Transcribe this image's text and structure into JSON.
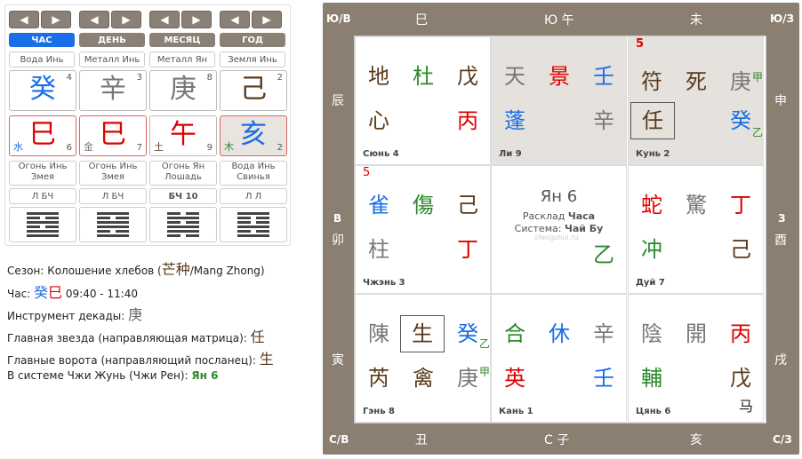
{
  "nav": [
    "◀",
    "▶"
  ],
  "tabs": [
    {
      "label": "ЧАС",
      "active": true
    },
    {
      "label": "ДЕНЬ",
      "active": false
    },
    {
      "label": "МЕСЯЦ",
      "active": false
    },
    {
      "label": "ГОД",
      "active": false
    }
  ],
  "stem_elements": [
    "Вода Инь",
    "Металл Инь",
    "Металл Ян",
    "Земля Инь"
  ],
  "stems": [
    {
      "glyph": "癸",
      "num": "4",
      "color": "#1a6ee8"
    },
    {
      "glyph": "辛",
      "num": "3",
      "color": "#777"
    },
    {
      "glyph": "庚",
      "num": "8",
      "color": "#777"
    },
    {
      "glyph": "己",
      "num": "2",
      "color": "#5a3a1a"
    }
  ],
  "branches": [
    {
      "glyph": "巳",
      "num": "6",
      "elem": "水",
      "elem_color": "#1a6ee8",
      "color": "#d00"
    },
    {
      "glyph": "巳",
      "num": "7",
      "elem": "金",
      "elem_color": "#777",
      "color": "#d00"
    },
    {
      "glyph": "午",
      "num": "9",
      "elem": "土",
      "elem_color": "#5a3a1a",
      "color": "#d00"
    },
    {
      "glyph": "亥",
      "num": "2",
      "elem": "木",
      "elem_color": "#2a8a2a",
      "color": "#1a6ee8"
    }
  ],
  "animals": [
    [
      "Огонь Инь",
      "Змея"
    ],
    [
      "Огонь Инь",
      "Змея"
    ],
    [
      "Огонь Ян",
      "Лошадь"
    ],
    [
      "Вода Инь",
      "Свинья"
    ]
  ],
  "small": [
    "Л БЧ",
    "Л БЧ",
    "БЧ 10",
    "Л Л"
  ],
  "info": {
    "season_label": "Сезон: Колошение хлебов (",
    "season_cn": "芒种",
    "season_tail": "/Mang Zhong)",
    "hour_label": "Час: ",
    "hour_g1": "癸",
    "hour_g2": "巳",
    "hour_time": " 09:40 - 11:40",
    "decade_label": "Инструмент декады: ",
    "decade_val": "庚",
    "star_label": "Главная звезда (направляющая матрица): ",
    "star_val": "任",
    "gate_label": "Главные ворота (направляющий посланец): ",
    "gate_val": "生",
    "sys_label": "В системе Чжи Жунь (Чжи Рен): ",
    "sys_val": "Ян 6"
  },
  "board": {
    "nw": "Ю/В",
    "ne": "Ю/З",
    "sw": "С/В",
    "se": "С/З",
    "top": [
      "巳",
      "Ю 午",
      "未"
    ],
    "bottom": [
      "丑",
      "С 子",
      "亥"
    ],
    "left": [
      "辰",
      "В",
      "卯",
      "寅"
    ],
    "right": [
      "申",
      "З",
      "酉",
      "戌"
    ]
  },
  "palaces": {
    "xun": {
      "name": "Сюнь 4",
      "c": [
        [
          "地",
          "#5a3a1a"
        ],
        [
          "杜",
          "#2a8a2a"
        ],
        [
          "戊",
          "#5a3a1a"
        ],
        [
          "心",
          "#5a3a1a"
        ],
        [
          "丙",
          "#d00"
        ]
      ]
    },
    "li": {
      "name": "Ли 9",
      "c": [
        [
          "天",
          "#777"
        ],
        [
          "景",
          "#d00"
        ],
        [
          "壬",
          "#1a6ee8"
        ],
        [
          "蓬",
          "#1a6ee8"
        ],
        [
          "辛",
          "#777"
        ]
      ]
    },
    "kun": {
      "name": "Кунь 2",
      "num": "5",
      "c": [
        [
          "符",
          "#5a3a1a"
        ],
        [
          "死",
          "#5a3a1a"
        ],
        [
          "庚",
          "#777"
        ],
        [
          "甲",
          "#2a8a2a"
        ],
        [
          "任",
          "#5a3a1a"
        ],
        [
          "癸",
          "#1a6ee8"
        ],
        [
          "乙",
          "#2a8a2a"
        ]
      ]
    },
    "zhen": {
      "name": "Чжэнь 3",
      "num": "5",
      "c": [
        [
          "雀",
          "#1a6ee8"
        ],
        [
          "傷",
          "#2a8a2a"
        ],
        [
          "己",
          "#5a3a1a"
        ],
        [
          "柱",
          "#777"
        ],
        [
          "丁",
          "#d00"
        ]
      ]
    },
    "center": {
      "title": "Ян 6",
      "l1": "Расклад ",
      "l1b": "Часа",
      "l2": "Система: ",
      "l2b": "Чай Бу",
      "wm": "sfengshui.ru",
      "g": "乙"
    },
    "dui": {
      "name": "Дуй 7",
      "c": [
        [
          "蛇",
          "#d00"
        ],
        [
          "驚",
          "#777"
        ],
        [
          "丁",
          "#d00"
        ],
        [
          "冲",
          "#2a8a2a"
        ],
        [
          "己",
          "#5a3a1a"
        ]
      ]
    },
    "gen": {
      "name": "Гэнь 8",
      "c": [
        [
          "陳",
          "#777"
        ],
        [
          "生",
          "#5a3a1a"
        ],
        [
          "癸",
          "#1a6ee8"
        ],
        [
          "乙",
          "#2a8a2a"
        ],
        [
          "芮",
          "#5a3a1a"
        ],
        [
          "禽",
          "#5a3a1a"
        ],
        [
          "庚",
          "#777"
        ],
        [
          "甲",
          "#2a8a2a"
        ]
      ]
    },
    "kan": {
      "name": "Кань 1",
      "c": [
        [
          "合",
          "#2a8a2a"
        ],
        [
          "休",
          "#1a6ee8"
        ],
        [
          "辛",
          "#777"
        ],
        [
          "英",
          "#d00"
        ],
        [
          "壬",
          "#1a6ee8"
        ]
      ]
    },
    "qian": {
      "name": "Цянь 6",
      "c": [
        [
          "陰",
          "#777"
        ],
        [
          "開",
          "#777"
        ],
        [
          "丙",
          "#d00"
        ],
        [
          "輔",
          "#2a8a2a"
        ],
        [
          "戊",
          "#5a3a1a"
        ],
        [
          "马",
          "#222"
        ]
      ]
    }
  }
}
